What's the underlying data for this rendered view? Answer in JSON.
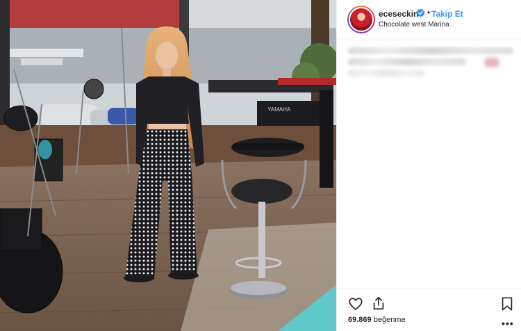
{
  "post": {
    "photo_alt": "Woman standing on a stage with music equipment",
    "icons": {
      "verified": "verified-badge-icon",
      "like": "heart-outline-icon",
      "share": "share-upload-icon",
      "save": "bookmark-outline-icon",
      "more": "more-horizontal-icon"
    }
  },
  "header": {
    "username": "eceseckin",
    "separator": "•",
    "follow_label": "Takip Et",
    "location": "Chocolate west Marina"
  },
  "footer": {
    "likes_number": "69.869",
    "likes_label": "beğenme",
    "more_label": "•••"
  },
  "colors": {
    "accent": "#3897f0",
    "text": "#262626",
    "border": "#efefef"
  }
}
